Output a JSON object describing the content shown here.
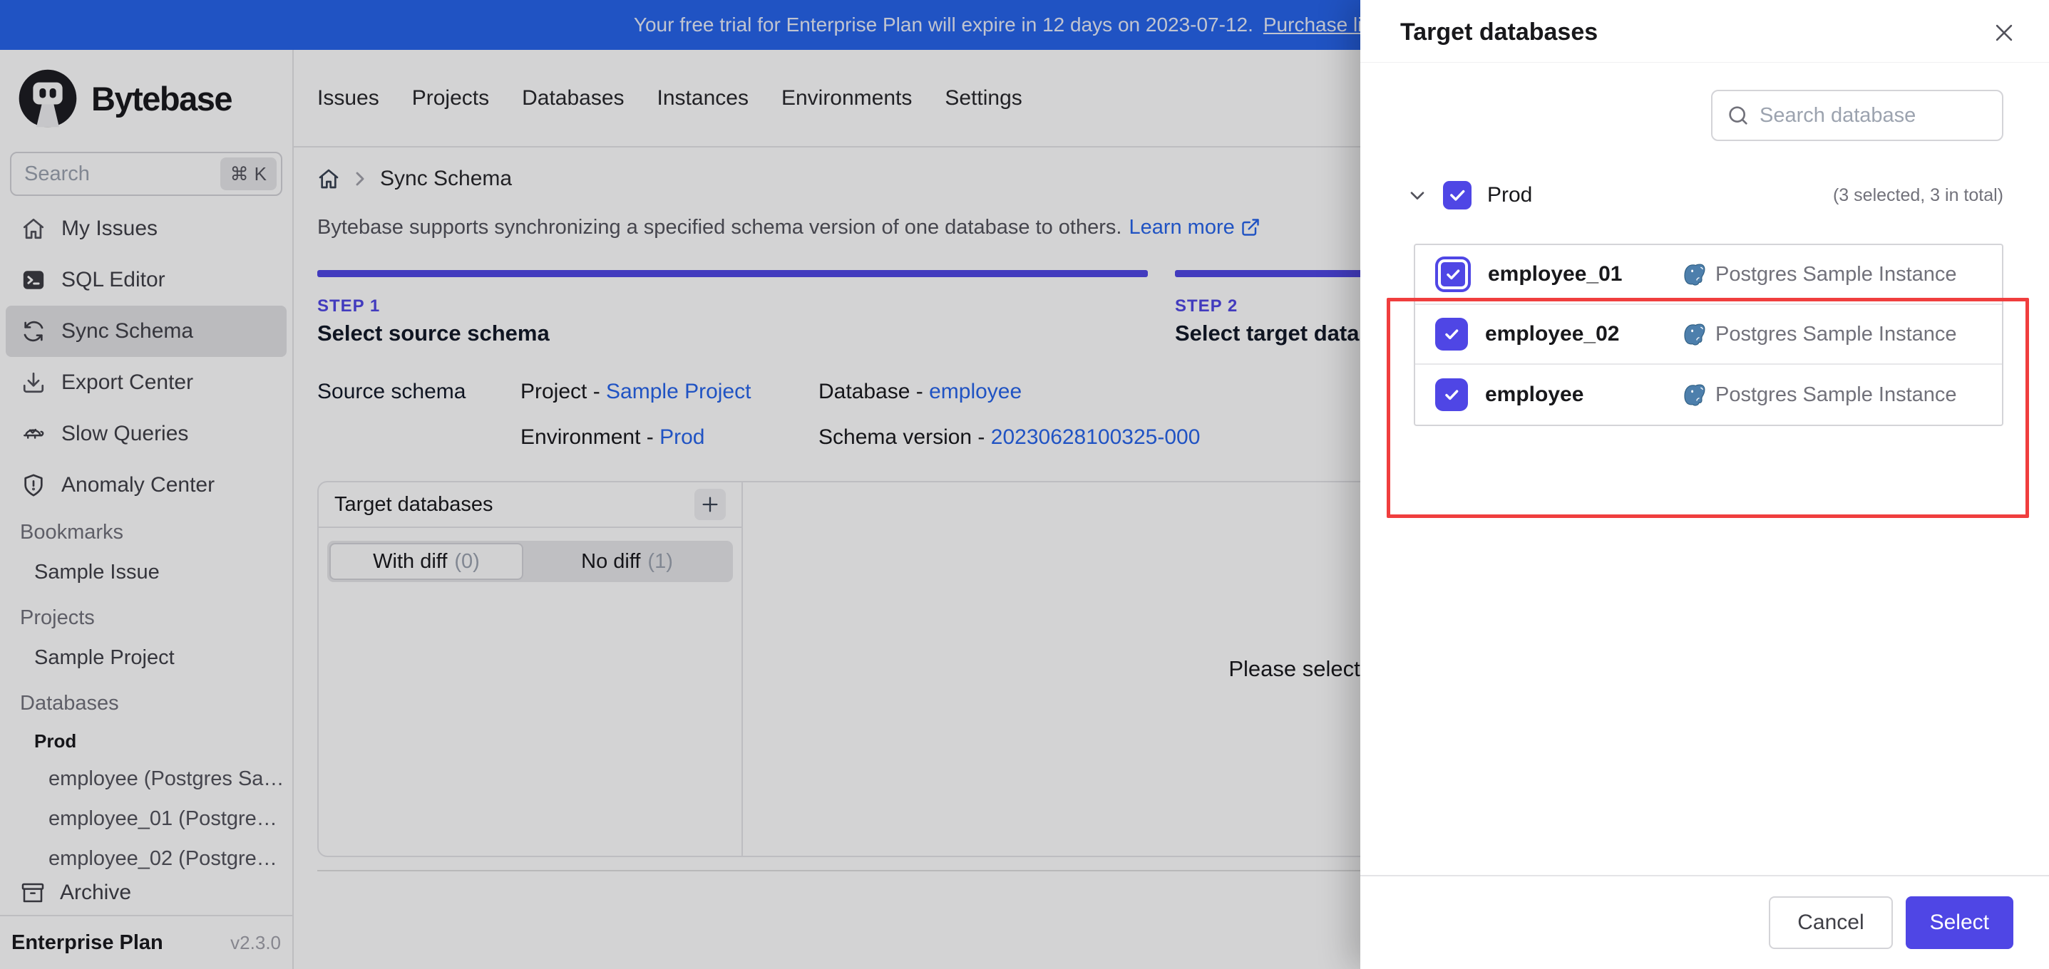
{
  "banner": {
    "message": "Your free trial for Enterprise Plan will expire in 12 days on 2023-07-12.",
    "link_label": "Purchase license"
  },
  "logo": {
    "name": "Bytebase"
  },
  "top_nav": {
    "items": [
      "Issues",
      "Projects",
      "Databases",
      "Instances",
      "Environments",
      "Settings"
    ]
  },
  "sidebar": {
    "search": {
      "placeholder": "Search",
      "shortcut_key": "K",
      "shortcut_mod": "⌘"
    },
    "nav": [
      {
        "label": "My Issues",
        "icon": "home-icon"
      },
      {
        "label": "SQL Editor",
        "icon": "terminal-icon"
      },
      {
        "label": "Sync Schema",
        "icon": "sync-icon"
      },
      {
        "label": "Export Center",
        "icon": "download-icon"
      },
      {
        "label": "Slow Queries",
        "icon": "turtle-icon"
      },
      {
        "label": "Anomaly Center",
        "icon": "shield-icon"
      }
    ],
    "bookmarks_title": "Bookmarks",
    "bookmarks": [
      "Sample Issue"
    ],
    "projects_title": "Projects",
    "projects": [
      "Sample Project"
    ],
    "databases_title": "Databases",
    "database_group": "Prod",
    "databases": [
      "employee (Postgres Sa…",
      "employee_01 (Postgre…",
      "employee_02 (Postgre…"
    ],
    "archive_label": "Archive",
    "footer": {
      "plan": "Enterprise Plan",
      "version": "v2.3.0"
    }
  },
  "main": {
    "breadcrumb": {
      "page": "Sync Schema"
    },
    "description": "Bytebase supports synchronizing a specified schema version of one database to others.",
    "learn_more": "Learn more",
    "steps": [
      {
        "kicker": "STEP 1",
        "title": "Select source schema"
      },
      {
        "kicker": "STEP 2",
        "title": "Select target databases"
      }
    ],
    "source": {
      "label": "Source schema",
      "project_label": "Project - ",
      "project_value": "Sample Project",
      "database_label": "Database - ",
      "database_value": "employee",
      "environment_label": "Environment - ",
      "environment_value": "Prod",
      "version_label": "Schema version - ",
      "version_value": "20230628100325-000"
    },
    "panel": {
      "title": "Target databases",
      "tabs": [
        {
          "label": "With diff",
          "count": "(0)"
        },
        {
          "label": "No diff",
          "count": "(1)"
        }
      ],
      "placeholder": "Please select a target database"
    }
  },
  "modal": {
    "title": "Target databases",
    "search_placeholder": "Search database",
    "group": {
      "name": "Prod",
      "summary": "(3 selected, 3 in total)"
    },
    "databases": [
      {
        "name": "employee_01",
        "instance": "Postgres Sample Instance"
      },
      {
        "name": "employee_02",
        "instance": "Postgres Sample Instance"
      },
      {
        "name": "employee",
        "instance": "Postgres Sample Instance"
      }
    ],
    "cancel_label": "Cancel",
    "select_label": "Select"
  },
  "colors": {
    "accent": "#4f46e5",
    "banner_blue": "#2563eb",
    "link_blue": "#2563eb",
    "annotation_red": "#f03e3e",
    "postgres_blue": "#336791"
  }
}
